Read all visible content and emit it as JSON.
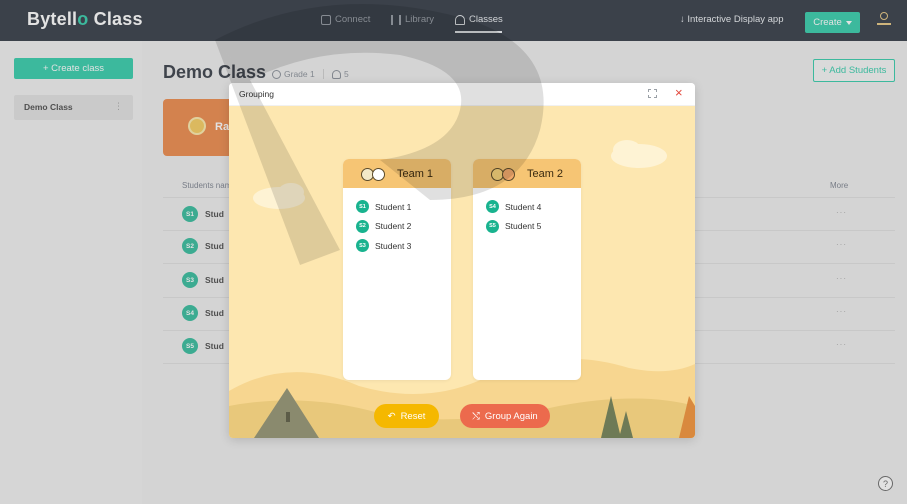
{
  "brand": {
    "prefix": "Bytell",
    "highlight": "o",
    "suffix": " Class"
  },
  "nav": {
    "connect": "Connect",
    "library": "Library",
    "classes": "Classes"
  },
  "header": {
    "interactive_display": "↓ Interactive Display app",
    "create": "Create"
  },
  "sidebar": {
    "create_class": "+ Create class",
    "classes": [
      "Demo Class"
    ]
  },
  "class": {
    "title": "Demo Class",
    "grade": "Grade 1",
    "count": "5",
    "add_students": "+ Add Students",
    "random_card": "Ra"
  },
  "table": {
    "col_name": "Students nam",
    "col_more": "More",
    "rows": [
      {
        "badge": "S1",
        "name": "Stud",
        "more": "···"
      },
      {
        "badge": "S2",
        "name": "Stud",
        "more": "···"
      },
      {
        "badge": "S3",
        "name": "Stud",
        "more": "···"
      },
      {
        "badge": "S4",
        "name": "Stud",
        "more": "···"
      },
      {
        "badge": "S5",
        "name": "Stud",
        "more": "···"
      }
    ]
  },
  "modal": {
    "title": "Grouping",
    "close": "×",
    "teams": [
      {
        "name": "Team 1",
        "members": [
          {
            "badge": "S1",
            "name": "Student 1"
          },
          {
            "badge": "S2",
            "name": "Student 2"
          },
          {
            "badge": "S3",
            "name": "Student 3"
          }
        ]
      },
      {
        "name": "Team 2",
        "members": [
          {
            "badge": "S4",
            "name": "Student 4"
          },
          {
            "badge": "S5",
            "name": "Student 5"
          }
        ]
      }
    ],
    "reset": "Reset",
    "group_again": "Group Again"
  },
  "help": "?",
  "colors": {
    "accent": "#19c7a0",
    "topbar": "#18202d",
    "reset": "#f5b800",
    "group_again": "#ec6a4d",
    "close": "#e2473b"
  }
}
